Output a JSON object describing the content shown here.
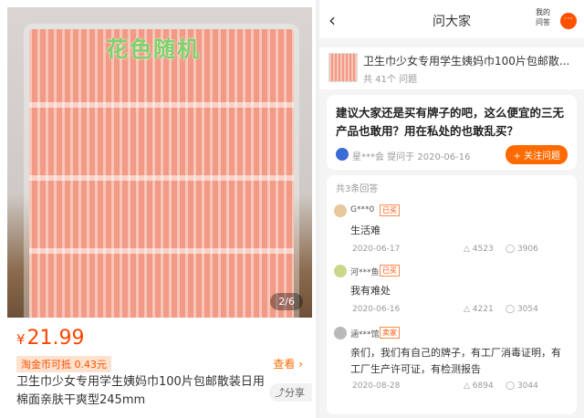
{
  "product": {
    "watermark": "花色随机",
    "page_indicator": "2/6",
    "price_symbol": "¥",
    "price": "21.99",
    "coupon": "淘金币可抵 0.43元",
    "view_label": "查看 ›",
    "title": "卫生巾少女专用学生姨妈巾100片包邮散装日用棉面亲肤干爽型245mm",
    "share_label": "分享"
  },
  "qa": {
    "back_icon": "chevron-left-icon",
    "header_title": "问大家",
    "my_questions": "我的问答",
    "product_name": "卫生巾少女专用学生姨妈巾100片包邮散...",
    "question_count": "共 41个 问题",
    "question": "建议大家还是买有牌子的吧，这么便宜的三无产品也敢用？用在私处的也敢乱买？",
    "asker": "星***会",
    "ask_date": "提问于 2020-06-16",
    "follow_label": "+ 关注问题",
    "answer_count": "共3条回答",
    "answers": [
      {
        "name": "G***0",
        "badge": "已买",
        "text": "生活难",
        "date": "2020-06-17",
        "likes": "4523",
        "comments": "3906"
      },
      {
        "name": "河***鱼",
        "badge": "已买",
        "text": "我有难处",
        "date": "2020-06-16",
        "likes": "4221",
        "comments": "3054"
      },
      {
        "name": "涵***馆",
        "badge": "卖家",
        "text": "亲们，我们有自己的牌子，有工厂消毒证明，有工厂生产许可证，有检测报告",
        "date": "2020-08-28",
        "likes": "6894",
        "comments": "3044"
      }
    ]
  },
  "colors": {
    "accent": "#ff5000",
    "price": "#ff4400"
  }
}
